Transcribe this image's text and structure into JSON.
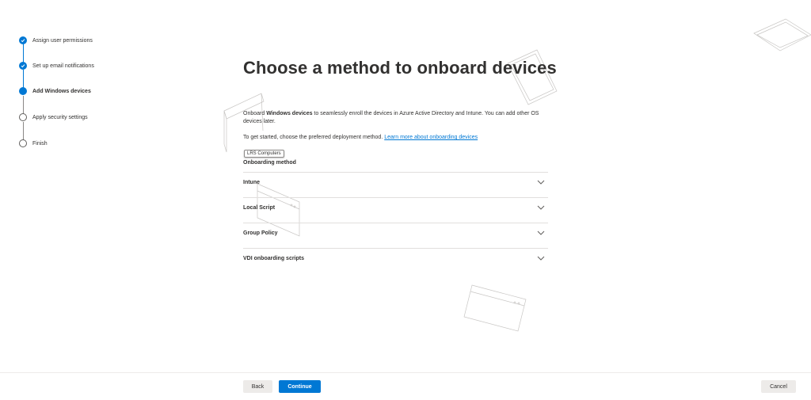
{
  "stepper": {
    "steps": [
      {
        "label": "Assign user permissions",
        "state": "done"
      },
      {
        "label": "Set up email notifications",
        "state": "done"
      },
      {
        "label": "Add Windows devices",
        "state": "current"
      },
      {
        "label": "Apply security settings",
        "state": "todo"
      },
      {
        "label": "Finish",
        "state": "todo"
      }
    ]
  },
  "main": {
    "title": "Choose a method to onboard devices",
    "description_pre": "Onboard ",
    "description_bold": "Windows devices",
    "description_post": " to seamlessly enroll the devices in Azure Active Directory and Intune. You can add other OS devices later.",
    "getting_started": "To get started, choose the preferred deployment method. ",
    "learn_more_link": "Learn more about onboarding devices",
    "tooltip": "LRS Computers",
    "onboarding_label": "Onboarding method",
    "methods": [
      {
        "label": "Intune"
      },
      {
        "label": "Local Script"
      },
      {
        "label": "Group Policy"
      },
      {
        "label": "VDI onboarding scripts"
      }
    ]
  },
  "footer": {
    "back_label": "Back",
    "continue_label": "Continue",
    "cancel_label": "Cancel"
  },
  "colors": {
    "accent": "#0078d4",
    "text": "#323130",
    "divider": "#e1dfdd"
  },
  "icons": {
    "done": "checkmark-circle-icon",
    "current": "filled-circle-icon",
    "todo": "empty-circle-icon",
    "expand": "chevron-down-icon"
  }
}
